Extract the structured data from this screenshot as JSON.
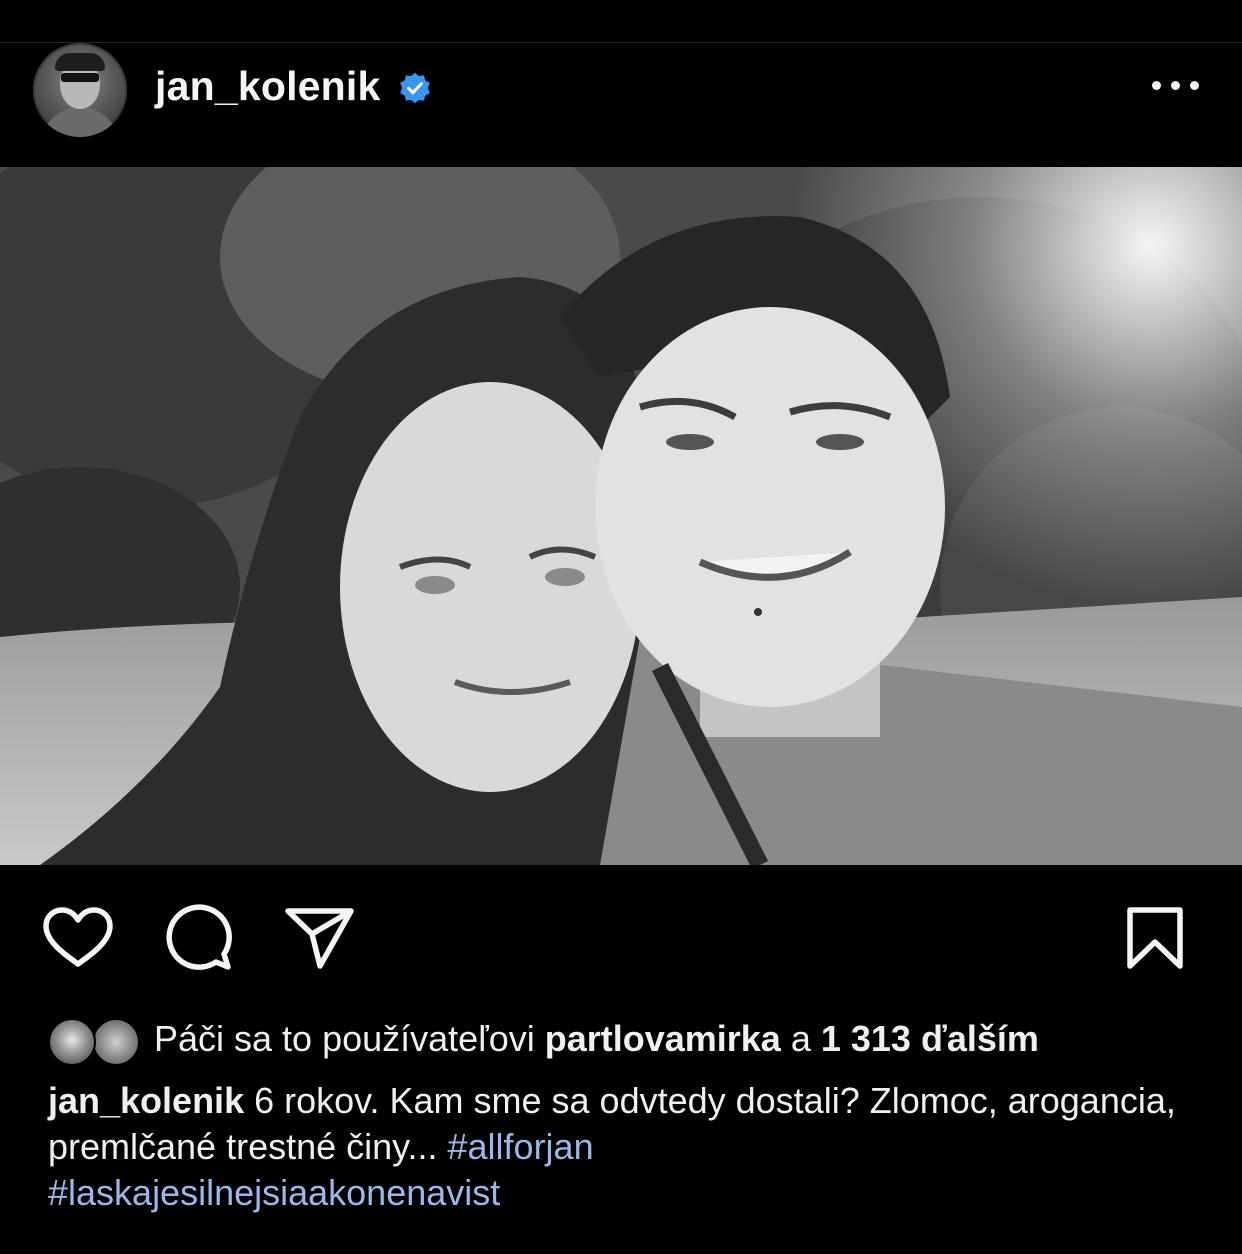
{
  "post": {
    "author": "jan_kolenik",
    "verified": true,
    "more_icon": "ellipsis-icon"
  },
  "actions": {
    "like_icon": "heart-icon",
    "comment_icon": "comment-icon",
    "share_icon": "paper-plane-icon",
    "save_icon": "bookmark-icon"
  },
  "likes": {
    "prefix": "Páči sa to používateľovi ",
    "user": "partlovamirka",
    "middle": " a ",
    "count": "1 313 ďalším"
  },
  "caption": {
    "username": "jan_kolenik",
    "text": " 6 rokov. Kam sme sa odvtedy dostali? Zlomoc, arogancia, premlčané trestné činy... ",
    "hashtag1": "#allforjan",
    "hashtag2": "#laskajesilnejsiaakonenavist"
  },
  "colors": {
    "background": "#000000",
    "text": "#f5f5f5",
    "verified_badge": "#3897f0",
    "hashtag": "#9fb7e8"
  }
}
